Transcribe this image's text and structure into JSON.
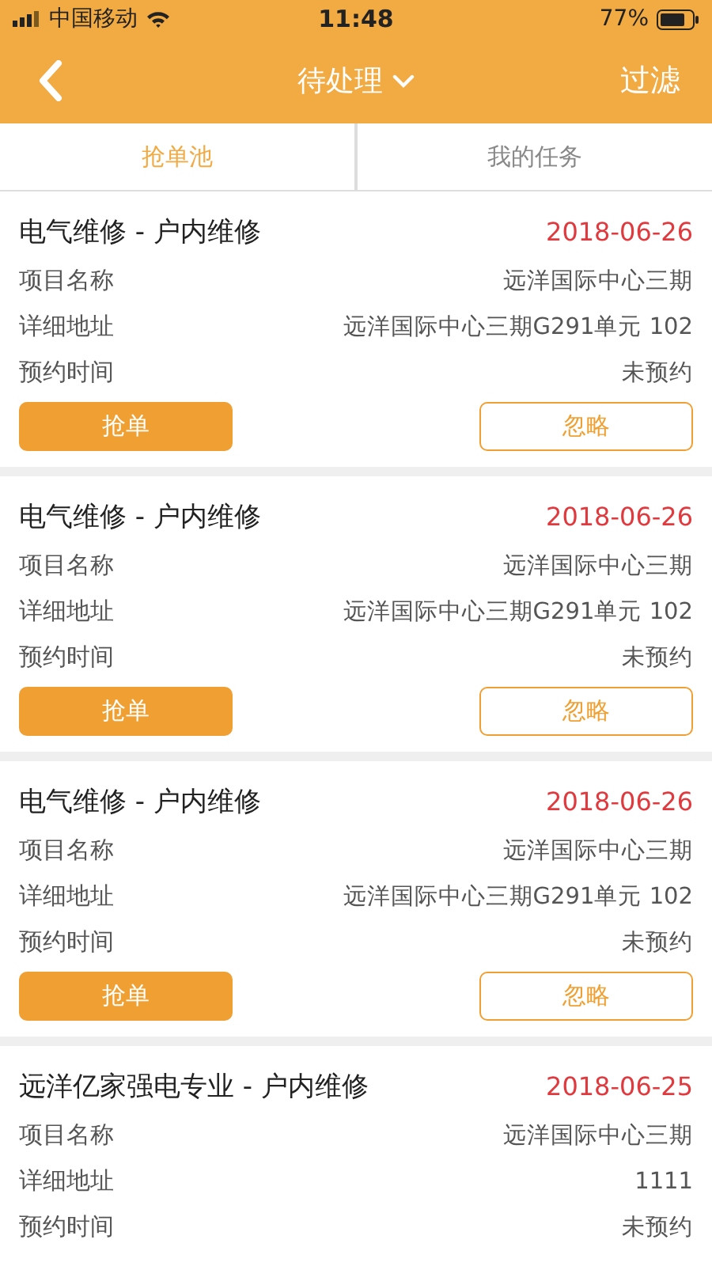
{
  "status_bar": {
    "carrier": "中国移动",
    "time": "11:48",
    "battery": "77%"
  },
  "nav": {
    "title": "待处理",
    "action": "过滤"
  },
  "tabs": [
    {
      "label": "抢单池",
      "selected": true
    },
    {
      "label": "我的任务",
      "selected": false
    }
  ],
  "orders": [
    {
      "title": "电气维修 - 户内维修",
      "date": "2018-06-26",
      "fields": [
        {
          "label": "项目名称",
          "value": "远洋国际中心三期"
        },
        {
          "label": "详细地址",
          "value": "远洋国际中心三期G291单元 102"
        },
        {
          "label": "预约时间",
          "value": "未预约"
        }
      ],
      "actions": [
        {
          "label": "抢单",
          "kind": "primary"
        },
        {
          "label": "忽略",
          "kind": "outline"
        }
      ]
    },
    {
      "title": "电气维修 - 户内维修",
      "date": "2018-06-26",
      "fields": [
        {
          "label": "项目名称",
          "value": "远洋国际中心三期"
        },
        {
          "label": "详细地址",
          "value": "远洋国际中心三期G291单元 102"
        },
        {
          "label": "预约时间",
          "value": "未预约"
        }
      ],
      "actions": [
        {
          "label": "抢单",
          "kind": "primary"
        },
        {
          "label": "忽略",
          "kind": "outline"
        }
      ]
    },
    {
      "title": "电气维修 - 户内维修",
      "date": "2018-06-26",
      "fields": [
        {
          "label": "项目名称",
          "value": "远洋国际中心三期"
        },
        {
          "label": "详细地址",
          "value": "远洋国际中心三期G291单元 102"
        },
        {
          "label": "预约时间",
          "value": "未预约"
        }
      ],
      "actions": [
        {
          "label": "抢单",
          "kind": "primary"
        },
        {
          "label": "忽略",
          "kind": "outline"
        }
      ]
    },
    {
      "title": "远洋亿家强电专业 - 户内维修",
      "date": "2018-06-25",
      "fields": [
        {
          "label": "项目名称",
          "value": "远洋国际中心三期"
        },
        {
          "label": "详细地址",
          "value": "1111"
        },
        {
          "label": "预约时间",
          "value": "未预约"
        }
      ]
    }
  ]
}
